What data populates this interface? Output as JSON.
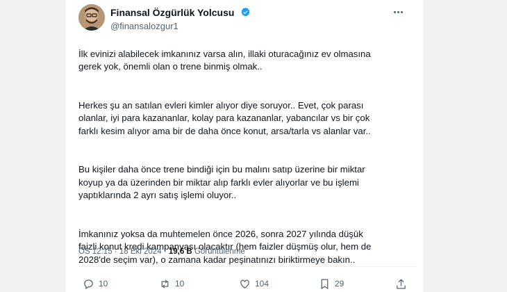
{
  "tweet": {
    "author": {
      "display_name": "Finansal Özgürlük Yolcusu",
      "handle": "@finansalozgur1",
      "verified": true
    },
    "paragraphs": [
      "İlk evinizi alabilecek imkanınız varsa alın, illaki oturacağınız ev olmasına\ngerek yok, önemli olan o trene binmiş olmak..",
      "Herkes şu an satılan evleri kimler alıyor diye soruyor.. Evet, çok parası\nolanlar, iyi para kazananlar, kolay para kazananlar, yabancılar vs bir çok\nfarklı kesim alıyor ama bir de daha önce konut, arsa/tarla vs alanlar var..",
      "Bu kişiler daha önce trene bindiği için bu malını satıp üzerine bir miktar\nkoyup ya da üzerinden bir miktar alıp farklı evler alıyorlar ve bu işlemi\nyaptıklarında 2 ayrı satış işlemi oluyor..",
      "İmkanınız yoksa da muhtemelen önce 2026, sonra 2027 yılında düşük\nfaizli konut kredi kampanyası olacaktır (hem faizler düşmüş olur, hem de\n2028'de seçim var), o zamana kadar peşinatınızı biriktirmeye bakın.."
    ],
    "time": "ÖS 12:15",
    "date": "18 Eki 2024",
    "views_count": "19,6 B",
    "views_label": "Görüntülenme",
    "separator": "·"
  },
  "actions": {
    "replies": "10",
    "retweets": "10",
    "likes": "104",
    "bookmarks": "29"
  },
  "colors": {
    "verified": "#1d9bf0",
    "secondary_text": "#536471",
    "primary_text": "#0f1419"
  },
  "icons": [
    "verified-badge-icon",
    "more-icon",
    "reply-icon",
    "retweet-icon",
    "like-icon",
    "bookmark-icon",
    "share-icon"
  ]
}
